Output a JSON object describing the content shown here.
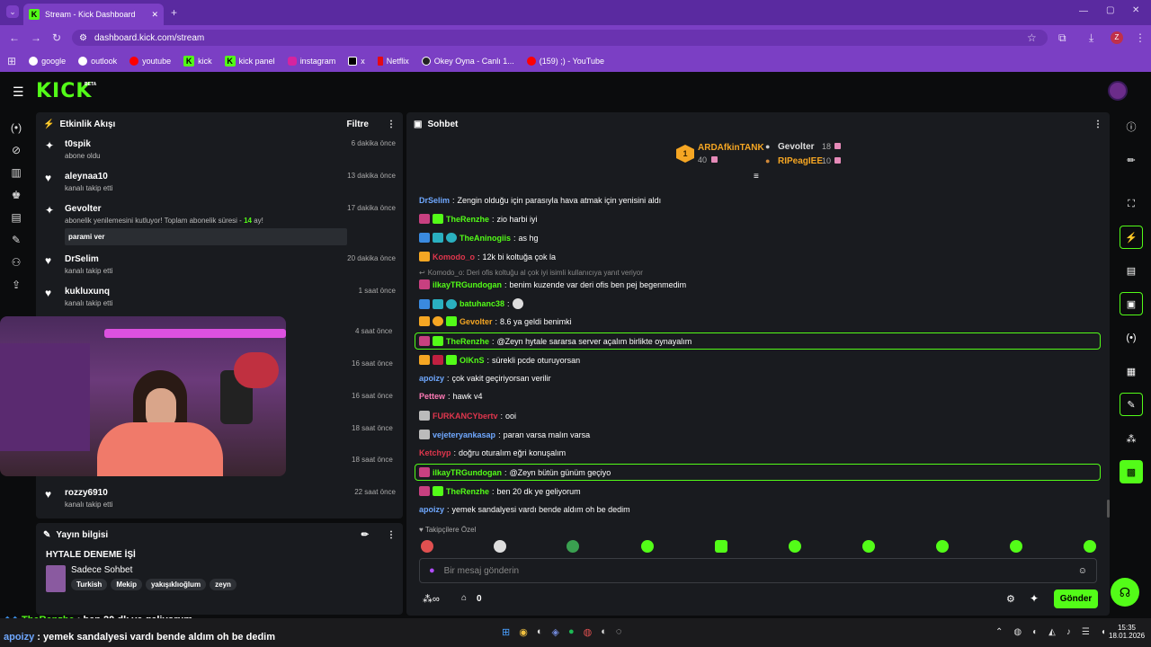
{
  "browser": {
    "tab_title": "Stream - Kick Dashboard",
    "url": "dashboard.kick.com/stream",
    "profile_initial": "Z",
    "bookmarks": [
      "google",
      "outlook",
      "youtube",
      "kick",
      "kick panel",
      "instagram",
      "x",
      "Netflix",
      "Okey Oyna - Canlı 1...",
      "(159) ;) - YouTube"
    ]
  },
  "kick": {
    "logo": "KICK",
    "beta": "BETA"
  },
  "activity": {
    "title": "Etkinlik Akışı",
    "filter": "Filtre",
    "items": [
      {
        "name": "t0spik",
        "sub": "abone oldu",
        "time": "6 dakika önce",
        "icon": "✦"
      },
      {
        "name": "aleynaa10",
        "sub": "kanalı takip etti",
        "time": "13 dakika önce",
        "icon": "♥"
      },
      {
        "name": "Gevolter",
        "sub": "abonelik yenilemesini kutluyor! Toplam abonelik süresi - ",
        "sub_num": "14",
        "sub_end": " ay!",
        "msg": "parami ver",
        "time": "17 dakika önce",
        "icon": "✦"
      },
      {
        "name": "DrSelim",
        "sub": "kanalı takip etti",
        "time": "20 dakika önce",
        "icon": "♥"
      },
      {
        "name": "kukluxunq",
        "sub": "kanalı takip etti",
        "time": "1 saat önce",
        "icon": "♥"
      }
    ],
    "hidden_times": [
      "4 saat önce",
      "16 saat önce",
      "16 saat önce",
      "18 saat önce",
      "18 saat önce"
    ],
    "last": {
      "name": "rozzy6910",
      "sub": "kanalı takip etti",
      "time": "22 saat önce",
      "icon": "♥"
    }
  },
  "stream_info": {
    "title": "Yayın bilgisi",
    "stream_title": "HYTALE DENEME İŞİ",
    "category": "Sadece Sohbet",
    "tags": [
      "Turkish",
      "Mekip",
      "yakışıklıoğlum",
      "zeyn"
    ]
  },
  "chat": {
    "title": "Sohbet",
    "leaders": {
      "first": {
        "name": "ARDAfkinTANK",
        "count": "40",
        "rank": "1"
      },
      "second": {
        "name": "Gevolter",
        "count": "18"
      },
      "third": {
        "name": "RIPeagIEE",
        "count": "10"
      }
    },
    "messages": [
      {
        "user": "DrSelim",
        "color": "#6fa8ff",
        "text": "Zengin olduğu için parasıyla hava atmak için yenisini aldı"
      },
      {
        "user": "TheRenzhe",
        "color": "#53fc18",
        "text": "zio harbi iyi"
      },
      {
        "user": "TheAninogiis",
        "color": "#53fc18",
        "text": "as hg"
      },
      {
        "user": "Komodo_o",
        "color": "#e0364d",
        "text": "12k bi koltuğa çok la"
      },
      {
        "reply": "Komodo_o: Deri ofis koltuğu al çok iyi isimli kullanıcıya yanıt veriyor"
      },
      {
        "user": "ilkayTRGundogan",
        "color": "#53fc18",
        "text": "benim kuzende var deri ofis ben pej begenmedim"
      },
      {
        "user": "batuhanc38",
        "color": "#53fc18",
        "text": ""
      },
      {
        "user": "Gevolter",
        "color": "#f5a623",
        "text": "8.6 ya geldi benimki"
      },
      {
        "user": "TheRenzhe",
        "color": "#53fc18",
        "text": "@Zeyn hytale sararsa server açalım birlikte oynayalım"
      },
      {
        "user": "OlKnS",
        "color": "#53fc18",
        "text": "sürekli pcde oturuyorsan"
      },
      {
        "user": "apoizy",
        "color": "#6fa8ff",
        "text": "çok vakit geçiriyorsan verilir"
      },
      {
        "user": "Pettew",
        "color": "#ff7ab6",
        "text": "hawk v4"
      },
      {
        "user": "FURKANCYbertv",
        "color": "#e0364d",
        "text": "ooi"
      },
      {
        "user": "vejeteryankasap",
        "color": "#6fa8ff",
        "text": "paran varsa malın varsa"
      },
      {
        "user": "Ketchyp",
        "color": "#e0364d",
        "text": "doğru oturalım eğri konuşalım"
      },
      {
        "user": "ilkayTRGundogan",
        "color": "#53fc18",
        "text": "@Zeyn bütün günüm geçiyo"
      },
      {
        "user": "TheRenzhe",
        "color": "#53fc18",
        "text": "ben 20 dk ye geliyorum"
      },
      {
        "user": "apoizy",
        "color": "#6fa8ff",
        "text": "yemek sandalyesi vardı bende aldım oh be dedim"
      }
    ],
    "followers_only": "Takipçilere Özel",
    "input_placeholder": "Bir mesaj gönderin",
    "send": "Gönder",
    "points": "0"
  },
  "overlay": {
    "line1_user": "TheRenzhe",
    "line1_text": " : ben 20 dk ye geliyorum",
    "line2_user": "apoizy",
    "line2_text": " : yemek sandalyesi vardı bende aldım oh be dedim"
  },
  "taskbar": {
    "time": "15:35",
    "date": "18.01.2026"
  }
}
